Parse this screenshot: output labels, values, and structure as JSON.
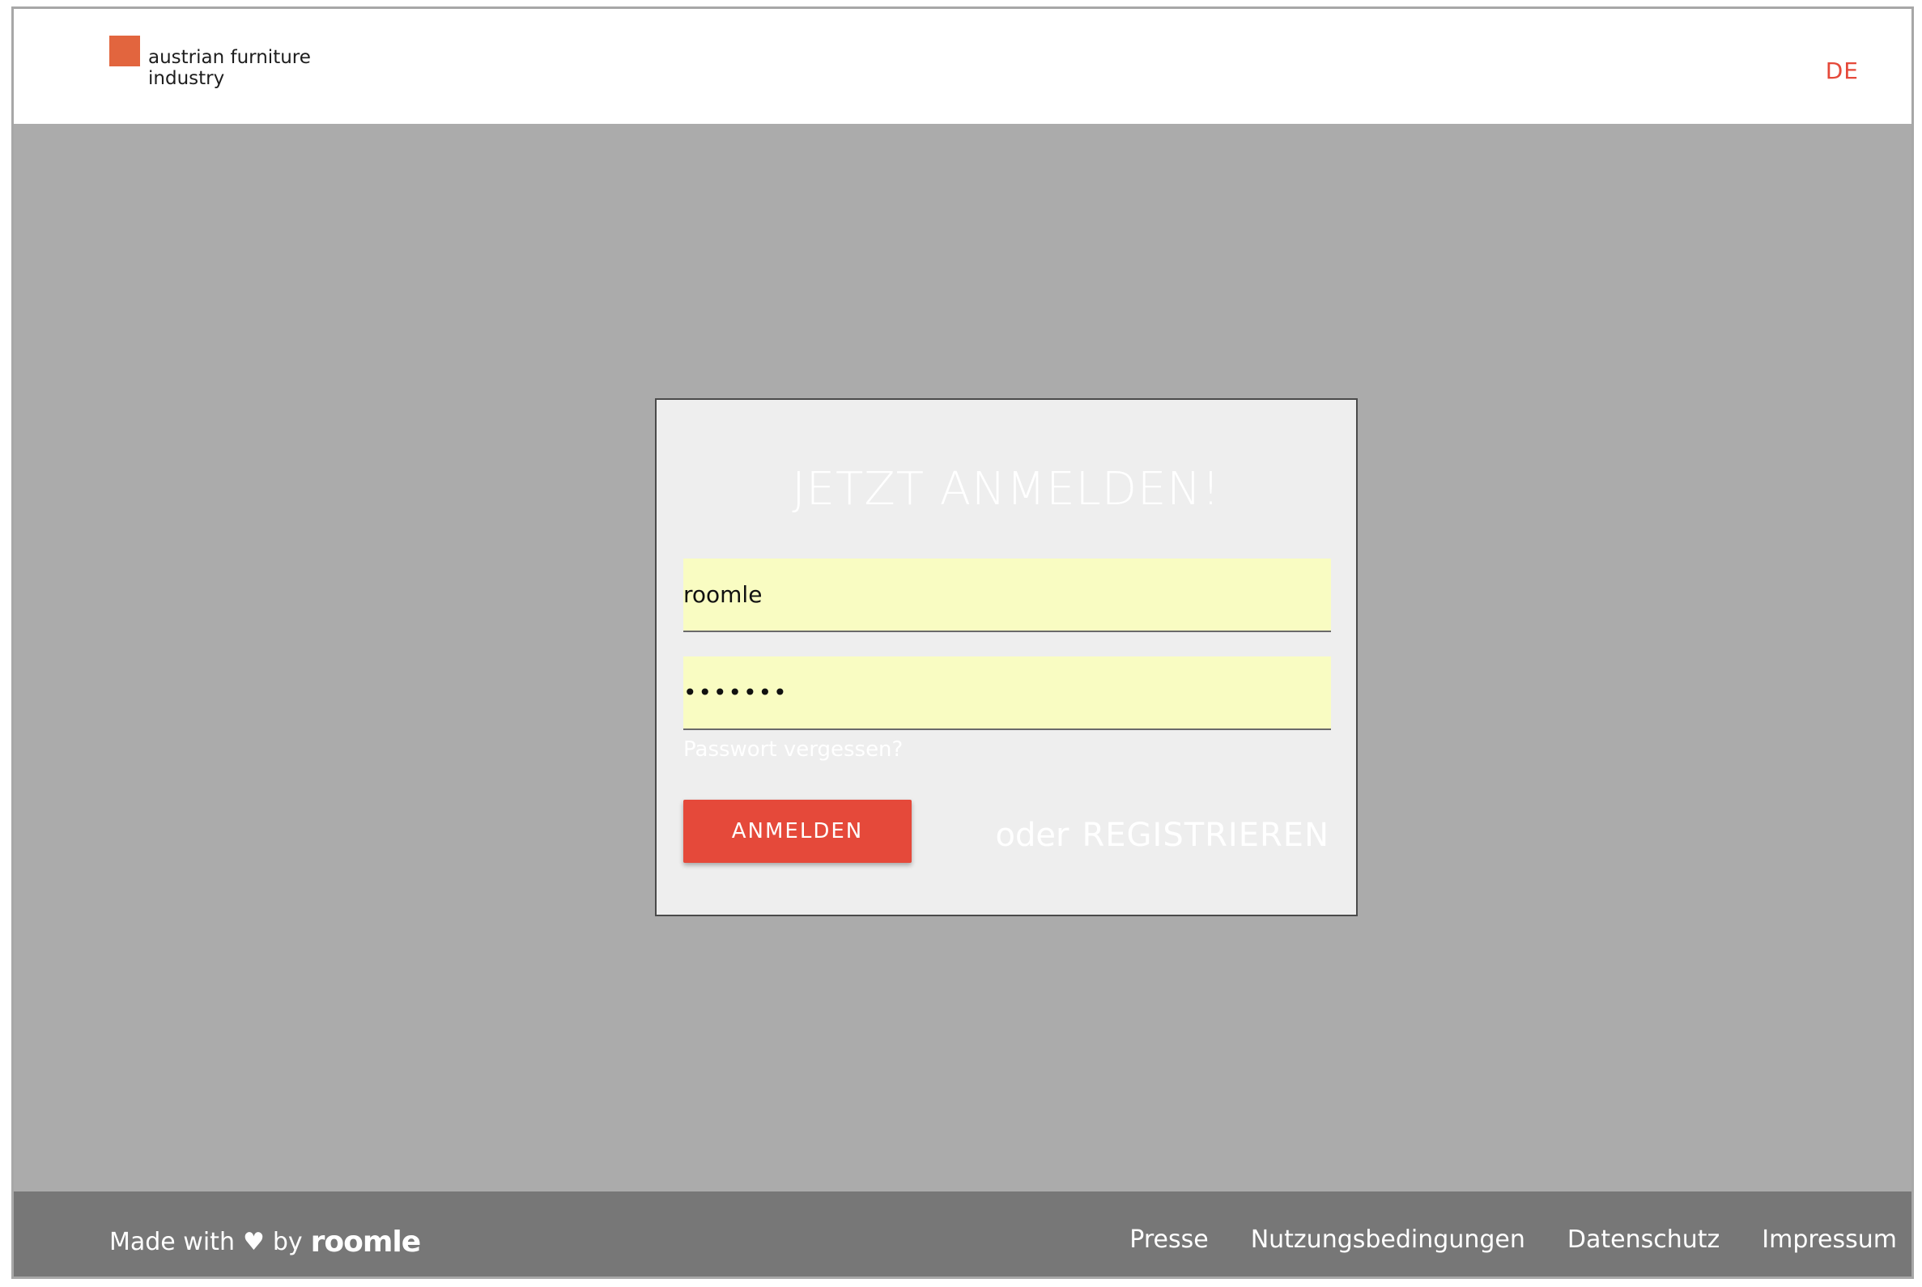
{
  "header": {
    "logo_text": "austrian furniture industry",
    "language": "DE"
  },
  "login": {
    "title": "JETZT ANMELDEN!",
    "username_value": "roomle",
    "password_value": "•••••••",
    "forgot_password": "Passwort vergessen?",
    "login_button": "ANMELDEN",
    "or_text": "oder",
    "register_link": "REGISTRIEREN"
  },
  "footer": {
    "made_with": "Made with",
    "heart_icon": "heart-icon",
    "by": "by",
    "brand": "roomle",
    "links": [
      "Presse",
      "Nutzungsbedingungen",
      "Datenschutz",
      "Impressum"
    ]
  },
  "colors": {
    "accent": "#e5493a",
    "logo_square": "#e2653e",
    "background": "#ababab",
    "card": "#eeeeee",
    "input_fill": "#f9fcc2",
    "footer": "#777777"
  }
}
